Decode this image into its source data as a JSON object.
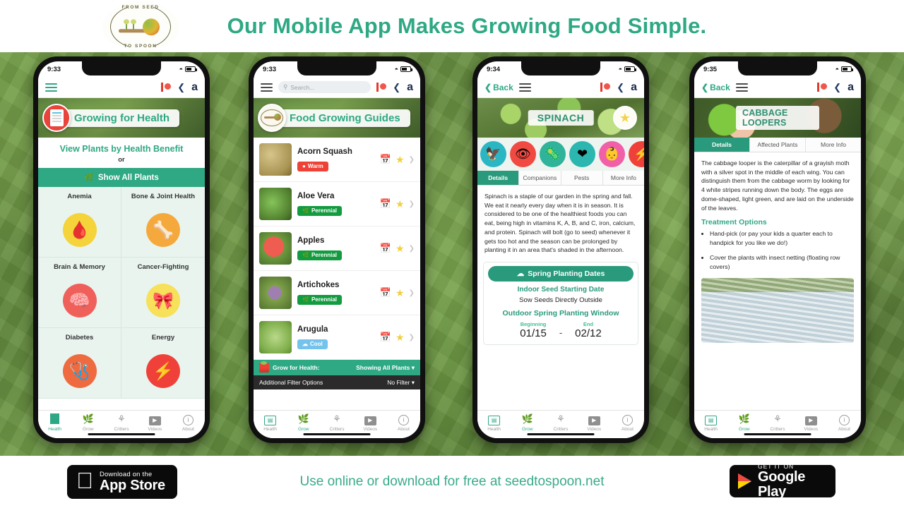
{
  "header": {
    "headline": "Our Mobile App Makes Growing Food Simple.",
    "logo": {
      "arc_top": "FROM SEED",
      "arc_bottom": "TO SPOON"
    },
    "accent_color": "#2fa884"
  },
  "footer": {
    "tagline": "Use online or download for free at seedtospoon.net",
    "app_store": {
      "small": "Download on the",
      "big": "App Store"
    },
    "google_play": {
      "small": "GET IT ON",
      "big": "Google Play"
    }
  },
  "tabbar": {
    "items": [
      {
        "label": "Health",
        "icon": "health-icon"
      },
      {
        "label": "Grow",
        "icon": "leaf-icon"
      },
      {
        "label": "Critters",
        "icon": "bug-icon"
      },
      {
        "label": "Videos",
        "icon": "play-icon"
      },
      {
        "label": "About",
        "icon": "info-icon"
      }
    ]
  },
  "phone1": {
    "status": {
      "time": "9:33",
      "wifi": "wifi-icon",
      "battery": "battery-icon"
    },
    "nav": {
      "menu": "hamburger-icon",
      "patreon": "patreon-icon",
      "share": "share-icon",
      "amazon": "amazon-icon"
    },
    "hero": {
      "title": "Growing for Health",
      "avatar": "plant-list-icon"
    },
    "subhead": "View Plants by Health Benefit",
    "or": "or",
    "show_all": "Show All Plants",
    "benefits": [
      {
        "label": "Anemia",
        "glyph": "🩸",
        "bg": "#f5d33a"
      },
      {
        "label": "Bone & Joint Health",
        "glyph": "🦴",
        "bg": "#f5a93c"
      },
      {
        "label": "Brain & Memory",
        "glyph": "🧠",
        "bg": "#f0605b"
      },
      {
        "label": "Cancer-Fighting",
        "glyph": "🎀",
        "bg": "#f7e05a"
      },
      {
        "label": "Diabetes",
        "glyph": "🩺",
        "bg": "#ef6a3f"
      },
      {
        "label": "Energy",
        "glyph": "⚡",
        "bg": "#f0403a"
      }
    ],
    "active_tab": 0
  },
  "phone2": {
    "status": {
      "time": "9:33"
    },
    "search_placeholder": "Search...",
    "hero": {
      "title": "Food Growing Guides",
      "avatar": "seed-to-spoon-logo"
    },
    "plants": [
      {
        "name": "Acorn Squash",
        "tag": "Warm",
        "tag_type": "warm",
        "thumb": "acorn-squash-photo"
      },
      {
        "name": "Aloe Vera",
        "tag": "Perennial",
        "tag_type": "perennial",
        "thumb": "aloe-vera-photo"
      },
      {
        "name": "Apples",
        "tag": "Perennial",
        "tag_type": "perennial",
        "thumb": "apples-photo"
      },
      {
        "name": "Artichokes",
        "tag": "Perennial",
        "tag_type": "perennial",
        "thumb": "artichokes-photo"
      },
      {
        "name": "Arugula",
        "tag": "Cool",
        "tag_type": "cool",
        "thumb": "arugula-photo"
      }
    ],
    "filter_bar": {
      "left": "Grow for Health:",
      "right": "Showing All Plants"
    },
    "filter_bar2": {
      "left": "Additional Filter Options",
      "right": "No Filter"
    },
    "active_tab": 1
  },
  "phone3": {
    "status": {
      "time": "9:34"
    },
    "back": "Back",
    "hero": {
      "title": "SPINACH"
    },
    "benefit_icons": [
      {
        "name": "anemia-icon",
        "bg": "#2bb6c4",
        "glyph": "🦅"
      },
      {
        "name": "eye-health-icon",
        "bg": "#f04a42",
        "glyph": "👁"
      },
      {
        "name": "antibacterial-icon",
        "bg": "#2fb39a",
        "glyph": "🦠"
      },
      {
        "name": "heart-health-icon",
        "bg": "#2bb6b0",
        "glyph": "❤"
      },
      {
        "name": "pregnancy-icon",
        "bg": "#f05fa8",
        "glyph": "👶"
      },
      {
        "name": "energy-icon",
        "bg": "#f0403a",
        "glyph": "⚡"
      }
    ],
    "tabs": [
      "Details",
      "Companions",
      "Pests",
      "More Info"
    ],
    "active_subtab": 0,
    "description": "Spinach is a staple of our garden in the spring and fall. We eat it nearly every day when it is in season. It is considered to be one of the healthiest foods you can eat, being high in vitamins K, A, B, and C, iron, calcium, and protein. Spinach will bolt (go to seed) whenever it gets too hot and the season can be prolonged by planting it in an area that's shaded in the afternoon.",
    "dates": {
      "header": "Spring Planting Dates",
      "indoor_label": "Indoor Seed Starting Date",
      "indoor_value": "Sow Seeds Directly Outside",
      "window_label": "Outdoor Spring Planting Window",
      "beginning_label": "Beginning",
      "beginning_value": "01/15",
      "dash": "-",
      "end_label": "End",
      "end_value": "02/12"
    },
    "active_tab": 1
  },
  "phone4": {
    "status": {
      "time": "9:35"
    },
    "back": "Back",
    "hero": {
      "title": "CABBAGE LOOPERS"
    },
    "tabs": [
      "Details",
      "Affected Plants",
      "More Info"
    ],
    "active_subtab": 0,
    "description": "The cabbage looper is the caterpillar of a grayish moth with a silver spot in the middle of each wing. You can distinguish them from the cabbage worm by looking for 4 white stripes running down the body. The eggs are dome-shaped, light green, and are laid on the underside of the leaves.",
    "treatment_heading": "Treatment Options",
    "treatments": [
      "Hand-pick (or pay your kids a quarter each to handpick for you like we do!)",
      "Cover the plants with insect netting (floating row covers)"
    ],
    "active_tab": 1
  }
}
